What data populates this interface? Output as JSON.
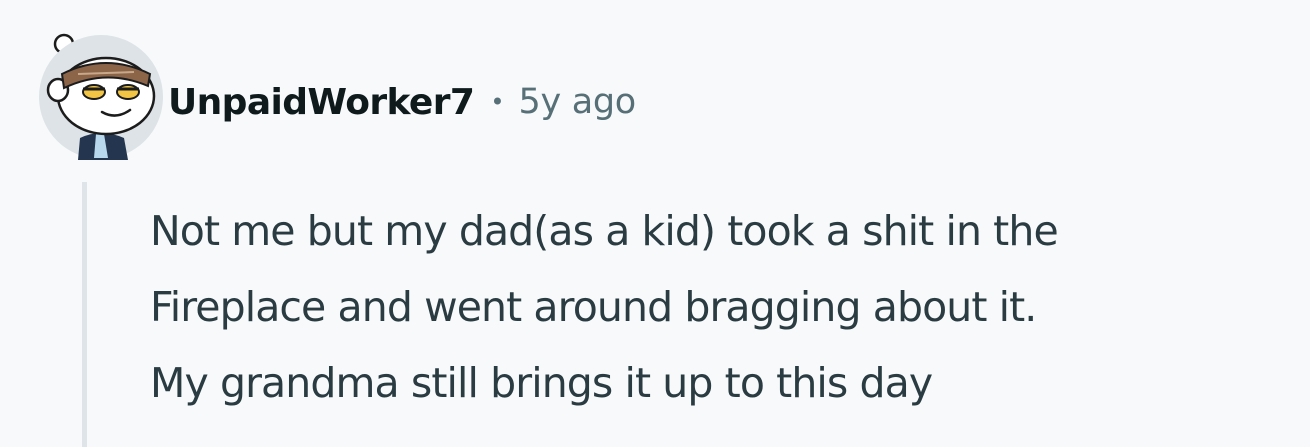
{
  "comment": {
    "author": "UnpaidWorker7",
    "separator": "•",
    "time_ago": "5y ago",
    "avatar_icon": "reddit-snoo-avatar-icon",
    "lines": [
      "Not me but my dad(as a kid) took a shit in the",
      "Fireplace and went around bragging about it.",
      "My grandma still brings it up to this day"
    ]
  },
  "colors": {
    "background": "#f7f9fa",
    "username": "#0f1a1c",
    "meta": "#576f76",
    "body": "#2a3c42",
    "thread_line": "#dfe4e8"
  }
}
